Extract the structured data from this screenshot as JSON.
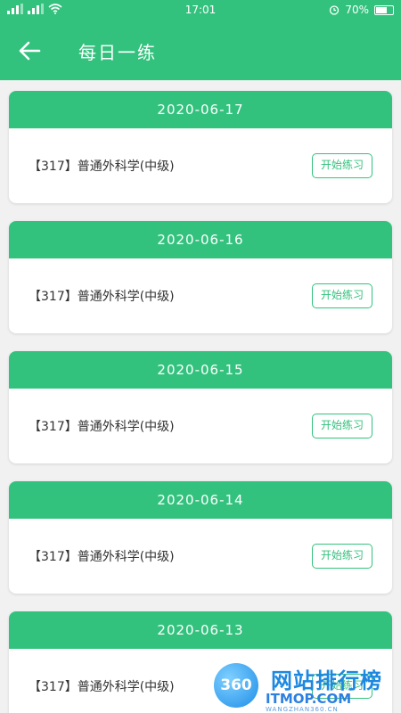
{
  "status_bar": {
    "time": "17:01",
    "battery": "70%",
    "battery_level": 0.7,
    "icons": [
      "signal-icon",
      "signal-icon",
      "wifi-icon",
      "alarm-icon",
      "battery-icon"
    ]
  },
  "header": {
    "title": "每日一练",
    "back_icon": "arrow-left-icon"
  },
  "practice_list": [
    {
      "date": "2020-06-17",
      "title": "【317】普通外科学(中级)",
      "button_label": "开始练习"
    },
    {
      "date": "2020-06-16",
      "title": "【317】普通外科学(中级)",
      "button_label": "开始练习"
    },
    {
      "date": "2020-06-15",
      "title": "【317】普通外科学(中级)",
      "button_label": "开始练习"
    },
    {
      "date": "2020-06-14",
      "title": "【317】普通外科学(中级)",
      "button_label": "开始练习"
    },
    {
      "date": "2020-06-13",
      "title": "【317】普通外科学(中级)",
      "button_label": "开始练习"
    }
  ],
  "watermark": {
    "logo_text": "360",
    "name": "网站排行榜",
    "domain": "ITMOP.COM",
    "sub": "WANGZHAN360.CN"
  },
  "colors": {
    "primary": "#33c27d",
    "background": "#f1f1f1",
    "card": "#ffffff",
    "text": "#333333",
    "watermark_blue": "#1d88e0"
  }
}
